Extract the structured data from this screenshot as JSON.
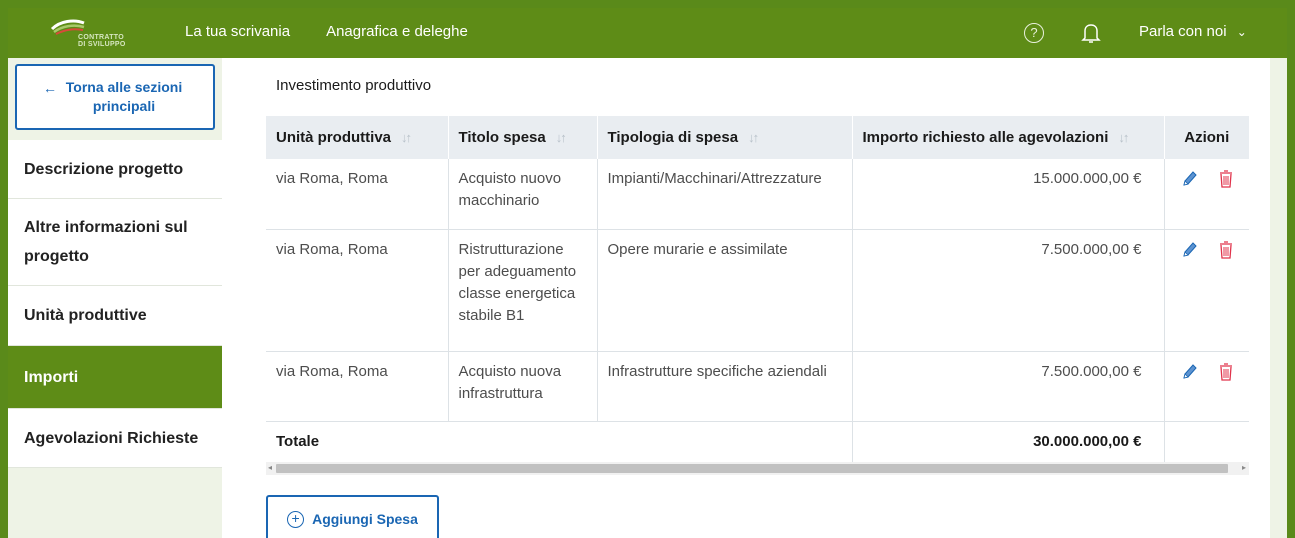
{
  "header": {
    "logo_text_line1": "CONTRATTO",
    "logo_text_line2": "DI SVILUPPO",
    "nav": [
      "La tua scrivania",
      "Anagrafica e deleghe"
    ],
    "help_icon": "question-circle-icon",
    "bell_icon": "bell-icon",
    "chat_label": "Parla con noi",
    "chat_chevron": "⌄"
  },
  "sidebar": {
    "back_arrow": "←",
    "back_label": "Torna alle sezioni principali",
    "items": [
      {
        "label": "Descrizione progetto",
        "active": false
      },
      {
        "label": "Altre informazioni sul progetto",
        "active": false
      },
      {
        "label": "Unità produttive",
        "active": false
      },
      {
        "label": "Importi",
        "active": true
      },
      {
        "label": "Agevolazioni Richieste",
        "active": false
      }
    ]
  },
  "content": {
    "section_title": "Investimento produttivo",
    "table": {
      "headers": [
        "Unità produttiva",
        "Titolo spesa",
        "Tipologia di spesa",
        "Importo richiesto alle agevolazioni",
        "Azioni"
      ],
      "sort_glyph": "↓↑",
      "rows": [
        {
          "unita": "via Roma, Roma",
          "titolo": "Acquisto nuovo macchinario",
          "tipologia": "Impianti/Macchinari/Attrezzature",
          "importo": "15.000.000,00 €"
        },
        {
          "unita": "via Roma, Roma",
          "titolo": "Ristrutturazione per adeguamento classe energetica stabile B1",
          "tipologia": "Opere murarie e assimilate",
          "importo": "7.500.000,00 €"
        },
        {
          "unita": "via Roma, Roma",
          "titolo": "Acquisto nuova infrastruttura",
          "tipologia": "Infrastrutture specifiche aziendali",
          "importo": "7.500.000,00 €"
        }
      ],
      "total_label": "Totale",
      "total_value": "30.000.000,00 €"
    },
    "add_button": "Aggiungi Spesa"
  },
  "colors": {
    "brand_green": "#5e8c17",
    "link_blue": "#1a66b3",
    "delete_red": "#e0334b"
  }
}
